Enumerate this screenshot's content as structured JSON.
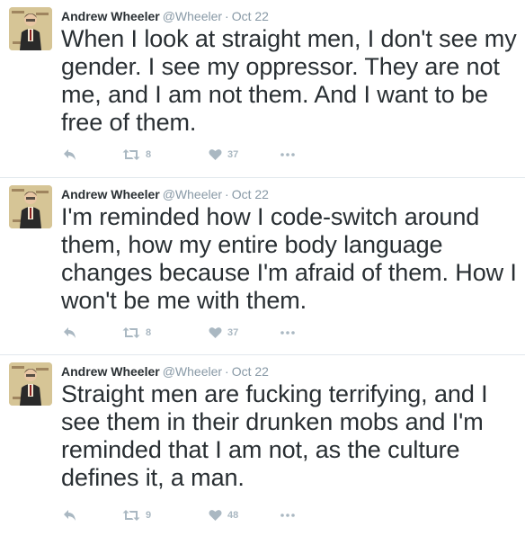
{
  "tweets": [
    {
      "name": "Andrew Wheeler",
      "handle": "@Wheeler",
      "dot": "·",
      "time": "Oct 22",
      "text": "When I look at straight men, I don't see my gender. I see my oppressor. They are not me, and I am not them. And I want to be free of them.",
      "retweets": "8",
      "likes": "37"
    },
    {
      "name": "Andrew Wheeler",
      "handle": "@Wheeler",
      "dot": "·",
      "time": "Oct 22",
      "text": "I'm reminded how I code-switch around them, how my entire body language changes because I'm afraid of them. How I won't be me with them.",
      "retweets": "8",
      "likes": "37"
    },
    {
      "name": "Andrew Wheeler",
      "handle": "@Wheeler",
      "dot": "·",
      "time": "Oct 22",
      "text": "Straight men are fucking terrifying, and I see them in their drunken mobs and I'm reminded that I am not, as the culture defines it, a man.",
      "retweets": "9",
      "likes": "48"
    }
  ],
  "icons": {
    "reply": "reply-icon",
    "retweet": "retweet-icon",
    "like": "heart-icon",
    "more": "more-icon"
  },
  "colors": {
    "text": "#292f33",
    "muted": "#8899a6",
    "action": "#aab8c2",
    "divider": "#e1e8ed"
  }
}
